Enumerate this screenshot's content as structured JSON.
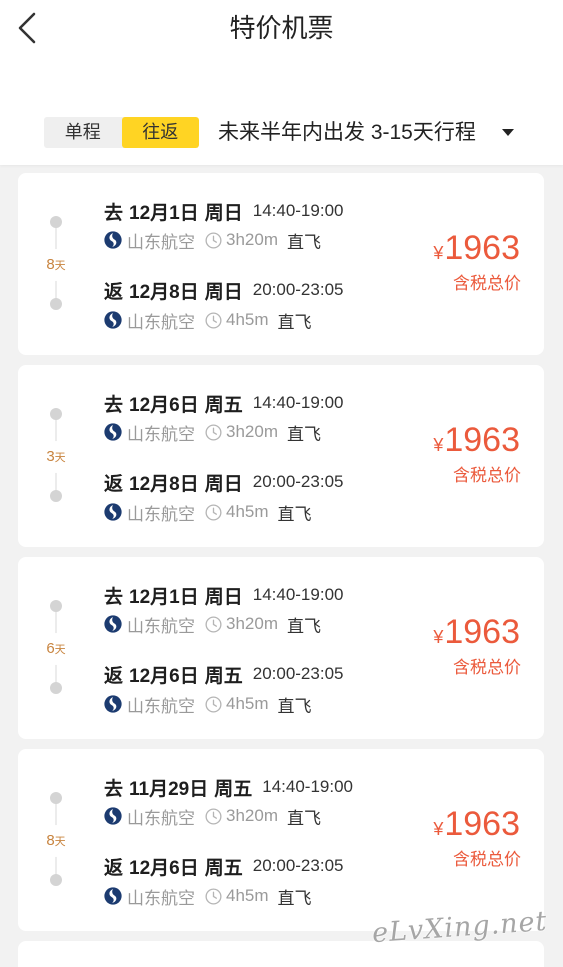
{
  "header": {
    "back_icon": "chevron-left-icon",
    "title": "特价机票"
  },
  "filter": {
    "trip_types": [
      {
        "label": "单程",
        "selected": false
      },
      {
        "label": "往返",
        "selected": true
      }
    ],
    "summary": "未来半年内出发 3-15天行程",
    "dropdown_icon": "caret-down-icon"
  },
  "icons": {
    "airline_logo": "shandong-airlines-logo-icon",
    "duration": "clock-icon"
  },
  "colors": {
    "accent": "#FFD423",
    "price": "#EB5A3C",
    "days": "#C8843F",
    "page_bg": "#F2F2F2",
    "airline_logo": "#1C3B70"
  },
  "offers": [
    {
      "days": "8",
      "days_unit": "天",
      "outbound": {
        "direction": "去",
        "date": "12月1日",
        "weekday": "周日",
        "time": "14:40-19:00",
        "airline": "山东航空",
        "duration": "3h20m",
        "stops": "直飞"
      },
      "inbound": {
        "direction": "返",
        "date": "12月8日",
        "weekday": "周日",
        "time": "20:00-23:05",
        "airline": "山东航空",
        "duration": "4h5m",
        "stops": "直飞"
      },
      "price": {
        "currency": "¥",
        "amount": "1963",
        "note": "含税总价"
      }
    },
    {
      "days": "3",
      "days_unit": "天",
      "outbound": {
        "direction": "去",
        "date": "12月6日",
        "weekday": "周五",
        "time": "14:40-19:00",
        "airline": "山东航空",
        "duration": "3h20m",
        "stops": "直飞"
      },
      "inbound": {
        "direction": "返",
        "date": "12月8日",
        "weekday": "周日",
        "time": "20:00-23:05",
        "airline": "山东航空",
        "duration": "4h5m",
        "stops": "直飞"
      },
      "price": {
        "currency": "¥",
        "amount": "1963",
        "note": "含税总价"
      }
    },
    {
      "days": "6",
      "days_unit": "天",
      "outbound": {
        "direction": "去",
        "date": "12月1日",
        "weekday": "周日",
        "time": "14:40-19:00",
        "airline": "山东航空",
        "duration": "3h20m",
        "stops": "直飞"
      },
      "inbound": {
        "direction": "返",
        "date": "12月6日",
        "weekday": "周五",
        "time": "20:00-23:05",
        "airline": "山东航空",
        "duration": "4h5m",
        "stops": "直飞"
      },
      "price": {
        "currency": "¥",
        "amount": "1963",
        "note": "含税总价"
      }
    },
    {
      "days": "8",
      "days_unit": "天",
      "outbound": {
        "direction": "去",
        "date": "11月29日",
        "weekday": "周五",
        "time": "14:40-19:00",
        "airline": "山东航空",
        "duration": "3h20m",
        "stops": "直飞"
      },
      "inbound": {
        "direction": "返",
        "date": "12月6日",
        "weekday": "周五",
        "time": "20:00-23:05",
        "airline": "山东航空",
        "duration": "4h5m",
        "stops": "直飞"
      },
      "price": {
        "currency": "¥",
        "amount": "1963",
        "note": "含税总价"
      }
    }
  ],
  "watermark": "eLvXing.net"
}
